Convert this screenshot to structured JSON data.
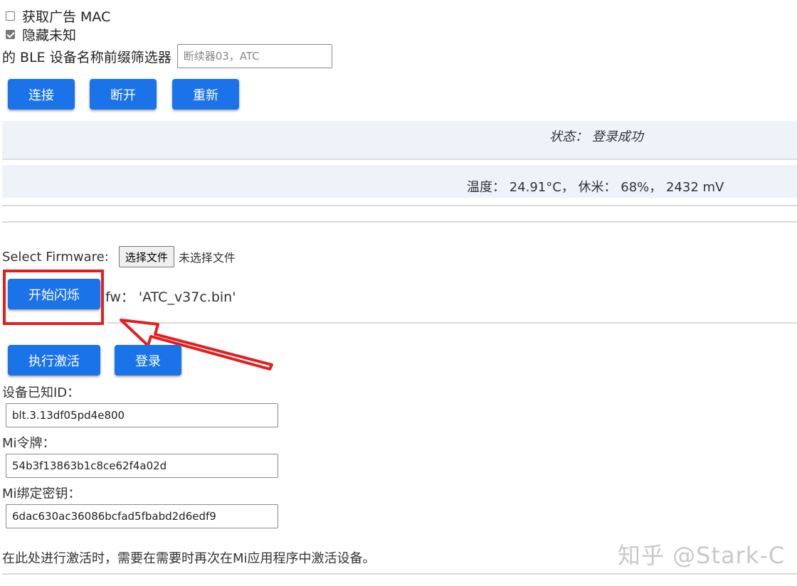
{
  "options": {
    "ad_mac_label": "获取广告 MAC",
    "ad_mac_checked": false,
    "hide_unknown_label": "隐藏未知",
    "hide_unknown_checked": true
  },
  "filter": {
    "label": "的 BLE 设备名称前缀筛选器",
    "placeholder": "断续器03，ATC"
  },
  "connection_buttons": {
    "connect": "连接",
    "disconnect": "断开",
    "reconnect": "重新"
  },
  "status": {
    "text": "状态： 登录成功"
  },
  "sensor": {
    "text": "温度： 24.91°C， 休米： 68%， 2432 mV"
  },
  "firmware": {
    "select_label": "Select Firmware:",
    "file_button": "选择文件",
    "no_file": "未选择文件",
    "flash_button": "开始闪烁",
    "fw_label": "fw： 'ATC_v37c.bin'"
  },
  "activation_buttons": {
    "activate": "执行激活",
    "login": "登录"
  },
  "fields": {
    "device_id_label": "设备已知ID：",
    "device_id_value": "blt.3.13df05pd4e800",
    "mi_token_label": "Mi令牌：",
    "mi_token_value": "54b3f13863b1c8ce62f4a02d",
    "mi_bind_key_label": "Mi绑定密钥：",
    "mi_bind_key_value": "6dac630ac36086bcfad5fbabd2d6edf9"
  },
  "note": "在此处进行激活时，需要在需要时再次在Mi应用程序中激活设备。",
  "watermark": "知乎 @Stark-C",
  "colors": {
    "button_blue": "#1a73e8",
    "band_bg": "#eef3fa",
    "annotation_red": "#e02020"
  }
}
